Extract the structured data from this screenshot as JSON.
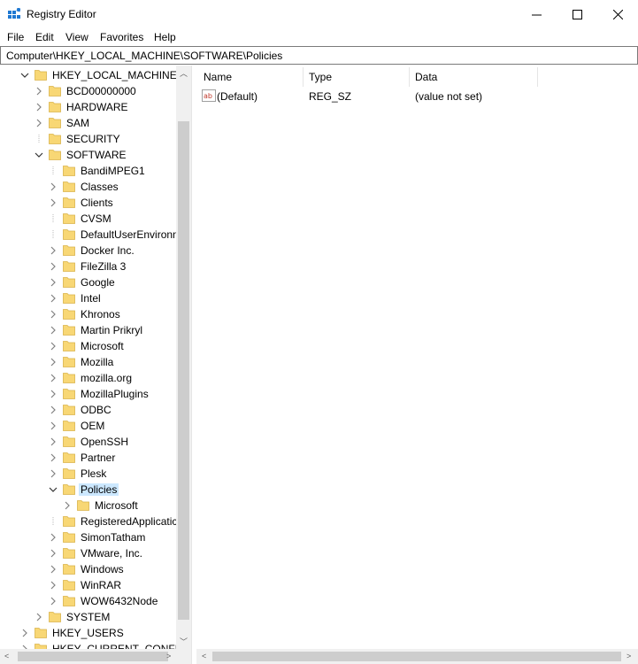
{
  "window": {
    "title": "Registry Editor"
  },
  "menu": [
    "File",
    "Edit",
    "View",
    "Favorites",
    "Help"
  ],
  "address": "Computer\\HKEY_LOCAL_MACHINE\\SOFTWARE\\Policies",
  "tree": [
    {
      "label": "HKEY_LOCAL_MACHINE",
      "level": 0,
      "state": "expanded"
    },
    {
      "label": "BCD00000000",
      "level": 1,
      "state": "collapsed"
    },
    {
      "label": "HARDWARE",
      "level": 1,
      "state": "collapsed"
    },
    {
      "label": "SAM",
      "level": 1,
      "state": "collapsed"
    },
    {
      "label": "SECURITY",
      "level": 1,
      "state": "leaf"
    },
    {
      "label": "SOFTWARE",
      "level": 1,
      "state": "expanded"
    },
    {
      "label": "BandiMPEG1",
      "level": 2,
      "state": "leaf"
    },
    {
      "label": "Classes",
      "level": 2,
      "state": "collapsed"
    },
    {
      "label": "Clients",
      "level": 2,
      "state": "collapsed"
    },
    {
      "label": "CVSM",
      "level": 2,
      "state": "leaf"
    },
    {
      "label": "DefaultUserEnvironn",
      "level": 2,
      "state": "leaf"
    },
    {
      "label": "Docker Inc.",
      "level": 2,
      "state": "collapsed"
    },
    {
      "label": "FileZilla 3",
      "level": 2,
      "state": "collapsed"
    },
    {
      "label": "Google",
      "level": 2,
      "state": "collapsed"
    },
    {
      "label": "Intel",
      "level": 2,
      "state": "collapsed"
    },
    {
      "label": "Khronos",
      "level": 2,
      "state": "collapsed"
    },
    {
      "label": "Martin Prikryl",
      "level": 2,
      "state": "collapsed"
    },
    {
      "label": "Microsoft",
      "level": 2,
      "state": "collapsed"
    },
    {
      "label": "Mozilla",
      "level": 2,
      "state": "collapsed"
    },
    {
      "label": "mozilla.org",
      "level": 2,
      "state": "collapsed"
    },
    {
      "label": "MozillaPlugins",
      "level": 2,
      "state": "collapsed"
    },
    {
      "label": "ODBC",
      "level": 2,
      "state": "collapsed"
    },
    {
      "label": "OEM",
      "level": 2,
      "state": "collapsed"
    },
    {
      "label": "OpenSSH",
      "level": 2,
      "state": "collapsed"
    },
    {
      "label": "Partner",
      "level": 2,
      "state": "collapsed"
    },
    {
      "label": "Plesk",
      "level": 2,
      "state": "collapsed"
    },
    {
      "label": "Policies",
      "level": 2,
      "state": "expanded",
      "selected": true
    },
    {
      "label": "Microsoft",
      "level": 3,
      "state": "collapsed"
    },
    {
      "label": "RegisteredApplicatic",
      "level": 2,
      "state": "leaf"
    },
    {
      "label": "SimonTatham",
      "level": 2,
      "state": "collapsed"
    },
    {
      "label": "VMware, Inc.",
      "level": 2,
      "state": "collapsed"
    },
    {
      "label": "Windows",
      "level": 2,
      "state": "collapsed"
    },
    {
      "label": "WinRAR",
      "level": 2,
      "state": "collapsed"
    },
    {
      "label": "WOW6432Node",
      "level": 2,
      "state": "collapsed"
    },
    {
      "label": "SYSTEM",
      "level": 1,
      "state": "collapsed"
    },
    {
      "label": "HKEY_USERS",
      "level": 0,
      "state": "collapsed"
    },
    {
      "label": "HKEY_CURRENT_CONFIG",
      "level": 0,
      "state": "collapsed"
    }
  ],
  "columns": [
    "Name",
    "Type",
    "Data"
  ],
  "values": [
    {
      "name": "(Default)",
      "type": "REG_SZ",
      "data": "(value not set)",
      "icon": "string-value-icon"
    }
  ],
  "icons": {
    "app": "registry-editor-icon",
    "folder": "folder-icon"
  },
  "colors": {
    "folder": "#f8d775",
    "selection": "#cce8ff"
  }
}
